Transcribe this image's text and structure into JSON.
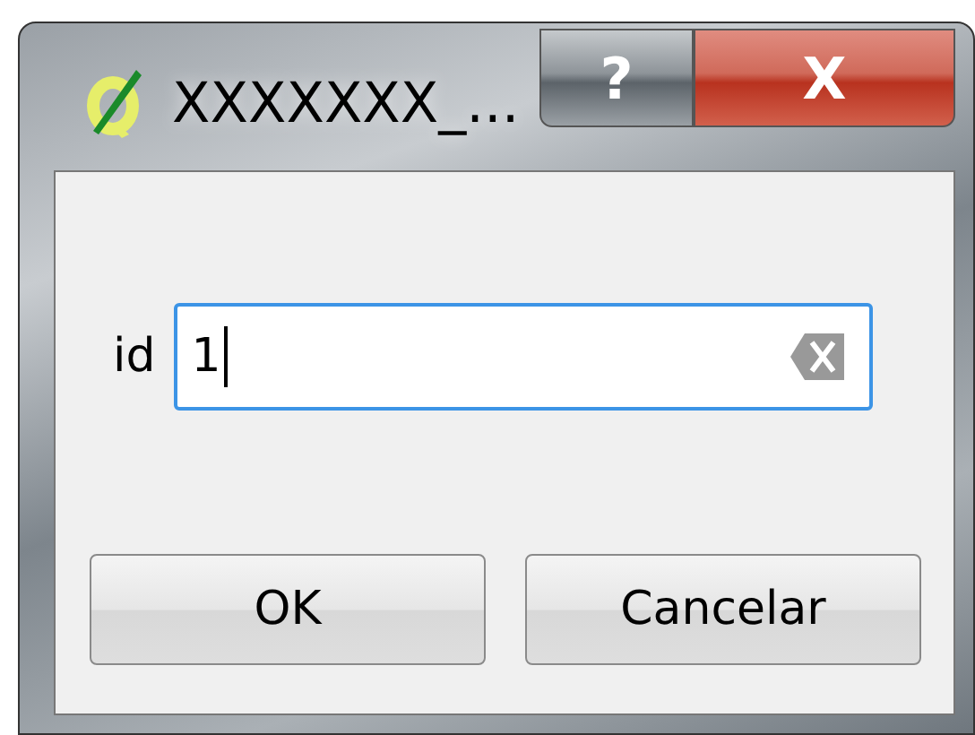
{
  "window": {
    "title": "XXXXXXX_..."
  },
  "title_buttons": [
    {
      "kind": "help",
      "label": "?"
    },
    {
      "kind": "close",
      "label": "X"
    }
  ],
  "field": {
    "label": "id",
    "value": "1",
    "focused": true
  },
  "buttons": [
    "OK",
    "Cancelar"
  ]
}
